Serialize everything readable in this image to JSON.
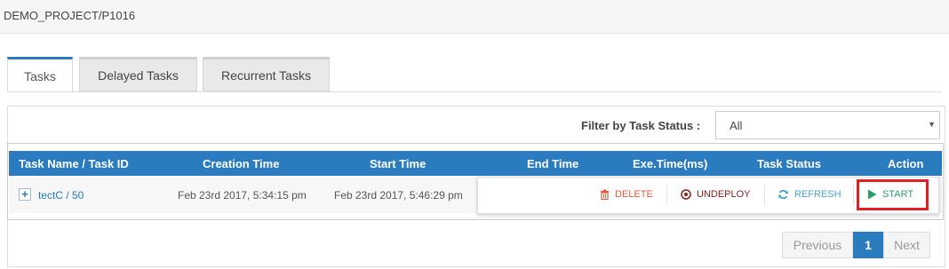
{
  "header": {
    "project_title": "DEMO_PROJECT/P1016"
  },
  "tabs": [
    {
      "label": "Tasks",
      "active": true
    },
    {
      "label": "Delayed Tasks",
      "active": false
    },
    {
      "label": "Recurrent Tasks",
      "active": false
    }
  ],
  "filter": {
    "label": "Filter by Task Status :",
    "selected": "All"
  },
  "table": {
    "columns": [
      "Task Name / Task ID",
      "Creation Time",
      "Start Time",
      "End Time",
      "Exe.Time(ms)",
      "Task Status",
      "Action"
    ],
    "rows": [
      {
        "expand": "+",
        "task": "tectC / 50",
        "creation_time": "Feb 23rd 2017, 5:34:15 pm",
        "start_time": "Feb 23rd 2017, 5:46:29 pm",
        "end_time": "",
        "exe_time": "",
        "status": ""
      }
    ]
  },
  "actions": {
    "delete": "DELETE",
    "undeploy": "UNDEPLOY",
    "refresh": "REFRESH",
    "start": "START"
  },
  "pagination": {
    "previous": "Previous",
    "current": "1",
    "next": "Next"
  },
  "colors": {
    "accent": "#2b7bbf",
    "highlight": "#e02020",
    "delete": "#e15a3a",
    "undeploy": "#8b1a1a",
    "refresh": "#4aa6c8",
    "start": "#2a9d6a"
  }
}
